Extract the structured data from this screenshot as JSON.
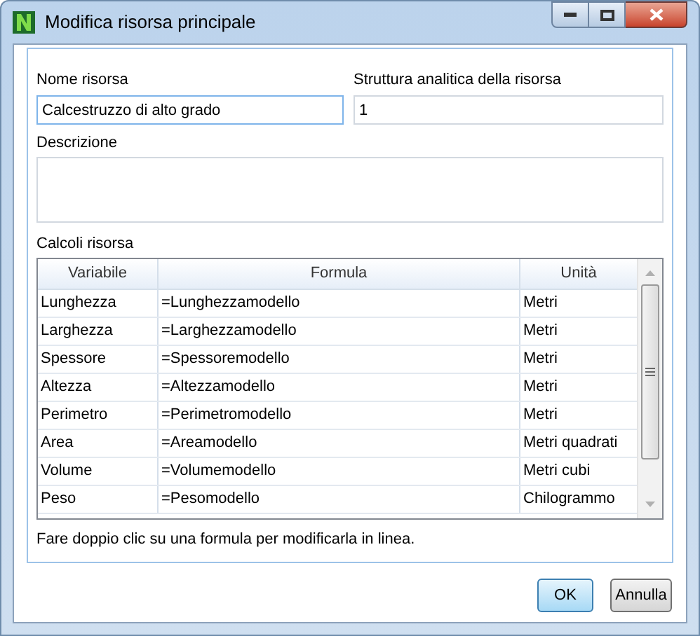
{
  "window": {
    "title": "Modifica risorsa principale"
  },
  "fields": [
    {
      "label": "Nome risorsa",
      "value": "Calcestruzzo di alto grado",
      "focused": true
    },
    {
      "label": "Struttura analitica della risorsa",
      "value": "1",
      "focused": false
    }
  ],
  "description": {
    "label": "Descrizione"
  },
  "table": {
    "label": "Calcoli risorsa",
    "columns": [
      "Variabile",
      "Formula",
      "Unità"
    ],
    "rows": [
      [
        "Lunghezza",
        "=Lunghezzamodello",
        "Metri"
      ],
      [
        "Larghezza",
        "=Larghezzamodello",
        "Metri"
      ],
      [
        "Spessore",
        "=Spessoremodello",
        "Metri"
      ],
      [
        "Altezza",
        "=Altezzamodello",
        "Metri"
      ],
      [
        "Perimetro",
        "=Perimetromodello",
        "Metri"
      ],
      [
        "Area",
        "=Areamodello",
        "Metri quadrati"
      ],
      [
        "Volume",
        "=Volumemodello",
        "Metri cubi"
      ],
      [
        "Peso",
        "=Pesomodello",
        "Chilogrammo"
      ]
    ]
  },
  "hint": "Fare doppio clic su una formula per modificarla in linea.",
  "buttons": [
    {
      "label": "OK",
      "default": true
    },
    {
      "label": "Annulla",
      "default": false
    }
  ]
}
